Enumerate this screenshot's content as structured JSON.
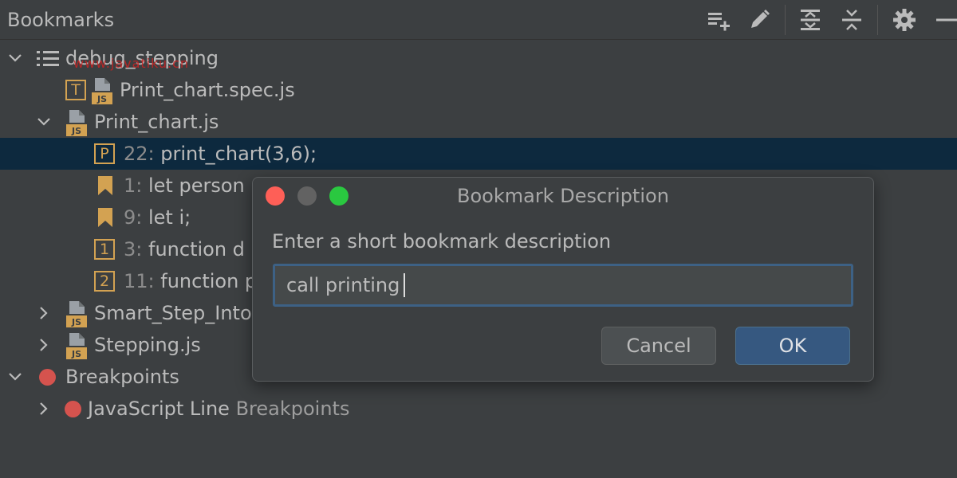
{
  "header": {
    "title": "Bookmarks",
    "toolbar": [
      {
        "icon": "add-list-icon"
      },
      {
        "icon": "edit-icon"
      },
      {
        "icon": "expand-all-icon"
      },
      {
        "icon": "collapse-all-icon"
      },
      {
        "icon": "gear-icon"
      },
      {
        "icon": "minimize-icon"
      }
    ]
  },
  "watermark": "www.javatiku.cn",
  "tree": {
    "group": "debug_stepping",
    "file_spec": "Print_chart.spec.js",
    "badge_t": "T",
    "file_print": "Print_chart.js",
    "sel_num": "22:",
    "sel_code": "print_chart(3,6);",
    "badge_p": "P",
    "bm1_num": "1:",
    "bm1_code": "let person",
    "bm2_num": "9:",
    "bm2_code": "let i;",
    "badge_1": "1",
    "bm3_num": "3:",
    "bm3_code": "function d",
    "badge_2": "2",
    "bm4_num": "11:",
    "bm4_code": "function p",
    "file_smart": "Smart_Step_Into",
    "file_stepping": "Stepping.js",
    "breakpoints": "Breakpoints",
    "js_bp_main": "JavaScript Line",
    "js_bp_dim": " Breakpoints"
  },
  "dialog": {
    "title": "Bookmark Description",
    "label": "Enter a short bookmark description",
    "input_value": "call printing",
    "cancel_label": "Cancel",
    "ok_label": "OK",
    "colors": {
      "close": "#fe5f57",
      "minimize": "#626262",
      "zoom": "#2ac840"
    }
  }
}
